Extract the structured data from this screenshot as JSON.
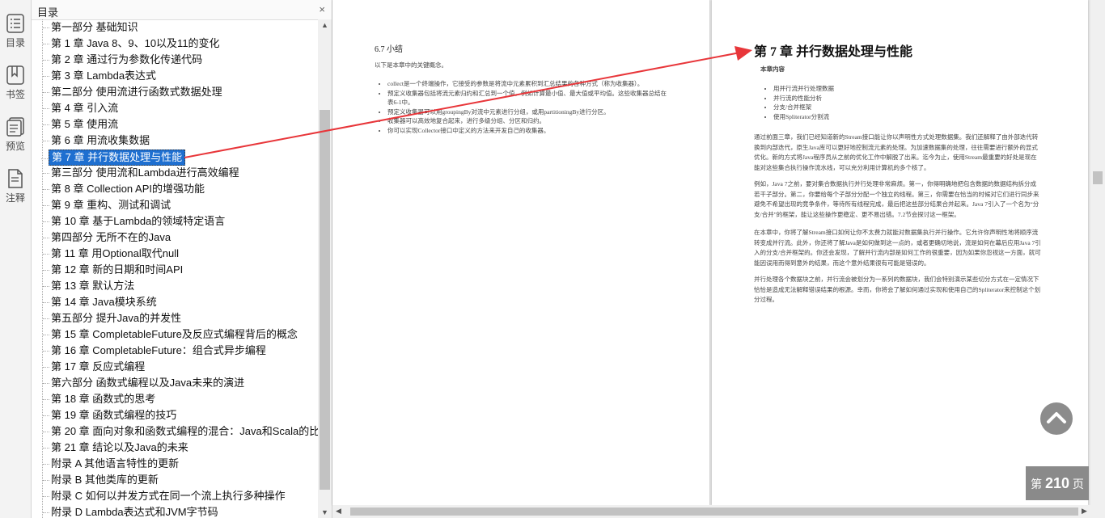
{
  "rail": [
    {
      "label": "目录",
      "icon": "toc-icon"
    },
    {
      "label": "书签",
      "icon": "bookmark-icon"
    },
    {
      "label": "预览",
      "icon": "preview-icon"
    },
    {
      "label": "注释",
      "icon": "annotation-icon"
    }
  ],
  "toc": {
    "title": "目录",
    "close": "×",
    "items": [
      "第一部分 基础知识",
      "第 1 章 Java 8、9、10以及11的变化",
      "第 2 章 通过行为参数化传递代码",
      "第 3 章 Lambda表达式",
      "第二部分 使用流进行函数式数据处理",
      "第 4 章 引入流",
      "第 5 章 使用流",
      "第 6 章 用流收集数据",
      "第 7 章 并行数据处理与性能",
      "第三部分 使用流和Lambda进行高效编程",
      "第 8 章 Collection API的增强功能",
      "第 9 章 重构、测试和调试",
      "第 10 章 基于Lambda的领域特定语言",
      "第四部分 无所不在的Java",
      "第 11 章 用Optional取代null",
      "第 12 章 新的日期和时间API",
      "第 13 章 默认方法",
      "第 14 章 Java模块系统",
      "第五部分 提升Java的并发性",
      "第 15 章 CompletableFuture及反应式编程背后的概念",
      "第 16 章 CompletableFuture：组合式异步编程",
      "第 17 章 反应式编程",
      "第六部分 函数式编程以及Java未来的演进",
      "第 18 章 函数式的思考",
      "第 19 章 函数式编程的技巧",
      "第 20 章 面向对象和函数式编程的混合：Java和Scala的比较",
      "第 21 章 结论以及Java的未来",
      "附录 A 其他语言特性的更新",
      "附录 B 其他类库的更新",
      "附录 C 如何以并发方式在同一个流上执行多种操作",
      "附录 D Lambda表达式和JVM字节码"
    ],
    "selected_index": 8
  },
  "left_page": {
    "heading": "6.7   小结",
    "intro": "以下是本章中的关键概念。",
    "bullets": [
      "collect是一个终端操作，它接受的参数是将流中元素累积到汇总结果的各种方式（称为收集器）。",
      "预定义收集器包括将流元素归约和汇总到一个值，例如计算最小值、最大值或平均值。这些收集器总结在表6-1中。",
      "预定义收集器可以用groupingBy对流中元素进行分组，或用partitioningBy进行分区。",
      "收集器可以高效地复合起来，进行多级分组、分区和归约。",
      "你可以实现Collector接口中定义的方法来开发自己的收集器。"
    ]
  },
  "right_page": {
    "chapter_title": "第 7 章   并行数据处理与性能",
    "contents_label": "本章内容",
    "contents": [
      "用并行流并行处理数据",
      "并行流的性能分析",
      "分支/合并框架",
      "使用Spliterator分割流"
    ],
    "paragraphs": [
      "通过前面三章，我们已经知道新的Stream接口能让你以声明性方式处理数据集。我们还解释了由外部迭代转换到内部迭代，原生Java库可以更好地控制流元素的处理。为加速数据集的处理，往往需要进行额外的显式优化。新的方式将Java程序员从之前的优化工作中解脱了出来。迄今为止，使用Stream最重要的好处是现在能对这些集合执行操作流水线，可以充分利用计算机的多个核了。",
      "例如，Java 7之前，要对集合数据执行并行处理非常麻烦。第一，你得明确地把包含数据的数据结构拆分成若干子部分。第二，你要给每个子部分分配一个独立的线程。第三，你需要在恰当的时候对它们进行同步来避免不希望出现的竞争条件，等待所有线程完成，最后把这些部分结果合并起来。Java 7引入了一个名为“分支/合并”的框架，能让这些操作更稳定、更不易出错。7.2节会探讨这一框架。",
      "在本章中，你将了解Stream接口如何让你不太费力就能对数据集执行并行操作。它允许你声明性地将顺序流转变成并行流。此外，你还将了解Java是如何做到这一点的，或者更确切地说，流是如何在幕后应用Java 7引入的分支/合并框架的。你还会发现，了解并行流内部是如何工作的很重要，因为如果你忽视这一方面，就可能因误用而得到意外的结果，而这个意外结果很有可能是错误的。",
      "并行处理各个数据块之前，并行流会被划分为一系列的数据块，我们会特别演示某些切分方式在一定情况下恰恰是造成无法解释错误结果的根源。幸而，你将会了解如何通过实现和使用自己的Spliterator来控制这个划分过程。"
    ]
  },
  "page_indicator": {
    "prefix": "第",
    "number": "210",
    "suffix": "页"
  },
  "colors": {
    "selection": "#1e6fd0",
    "arrow": "#e8363a"
  }
}
